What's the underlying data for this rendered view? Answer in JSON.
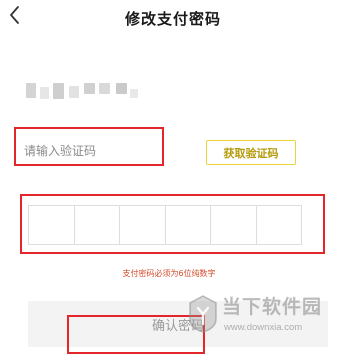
{
  "header": {
    "title": "修改支付密码",
    "back_icon": "chevron-left-icon"
  },
  "verification": {
    "code_placeholder": "请输入验证码",
    "code_value": "",
    "get_code_label": "获取验证码"
  },
  "password": {
    "box_count": 6,
    "hint": "支付密码必须为6位纯数字"
  },
  "confirm": {
    "label": "确认密码"
  },
  "watermark": {
    "name": "当下软件园",
    "url": "www.downxia.com"
  },
  "colors": {
    "highlight_red": "#e2262b",
    "accent_yellow": "#e8d43a",
    "hint_red": "#d64a2a",
    "button_bg": "#f3f3f3"
  }
}
